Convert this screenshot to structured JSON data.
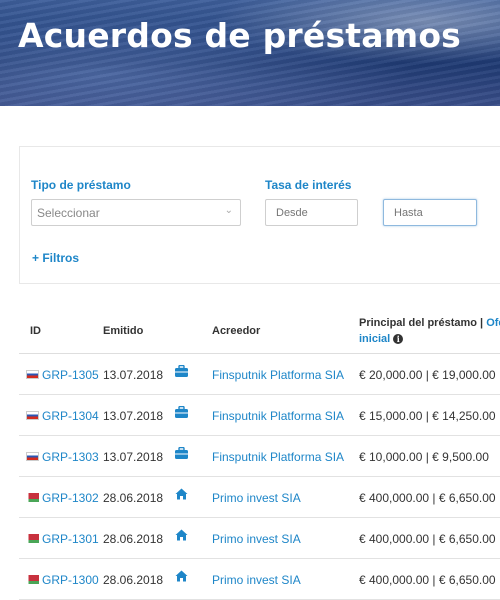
{
  "header": {
    "title": "Acuerdos de préstamos"
  },
  "filters": {
    "loan_type_label": "Tipo de préstamo",
    "loan_type_placeholder": "Seleccionar",
    "interest_label": "Tasa de interés",
    "from_placeholder": "Desde",
    "to_placeholder": "Hasta",
    "more_filters": "+ Filtros"
  },
  "table": {
    "headers": {
      "id": "ID",
      "issued": "Emitido",
      "creditor": "Acreedor",
      "principal": "Principal del préstamo |",
      "offer_part1": "Ofe",
      "offer_part2": "inicial"
    },
    "rows": [
      {
        "flag": "russia",
        "id": "GRP-1305",
        "date": "13.07.2018",
        "type_icon": "briefcase-icon",
        "creditor": "Finsputnik Platforma SIA",
        "amount": "€ 20,000.00 | € 19,000.00"
      },
      {
        "flag": "russia",
        "id": "GRP-1304",
        "date": "13.07.2018",
        "type_icon": "briefcase-icon",
        "creditor": "Finsputnik Platforma SIA",
        "amount": "€ 15,000.00 | € 14,250.00"
      },
      {
        "flag": "russia",
        "id": "GRP-1303",
        "date": "13.07.2018",
        "type_icon": "briefcase-icon",
        "creditor": "Finsputnik Platforma SIA",
        "amount": "€ 10,000.00 | € 9,500.00"
      },
      {
        "flag": "belarus",
        "id": "GRP-1302",
        "date": "28.06.2018",
        "type_icon": "home-icon",
        "creditor": "Primo invest SIA",
        "amount": "€ 400,000.00 | € 6,650.00"
      },
      {
        "flag": "belarus",
        "id": "GRP-1301",
        "date": "28.06.2018",
        "type_icon": "home-icon",
        "creditor": "Primo invest SIA",
        "amount": "€ 400,000.00 | € 6,650.00"
      },
      {
        "flag": "belarus",
        "id": "GRP-1300",
        "date": "28.06.2018",
        "type_icon": "home-icon",
        "creditor": "Primo invest SIA",
        "amount": "€ 400,000.00 | € 6,650.00"
      }
    ]
  },
  "colors": {
    "link": "#1e86c8",
    "text": "#333333",
    "icon": "#1e86c8"
  }
}
